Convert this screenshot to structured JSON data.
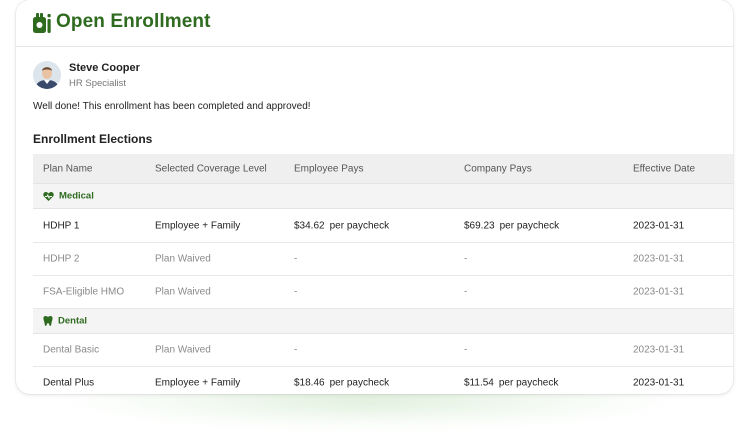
{
  "page": {
    "title": "Open Enrollment",
    "user": {
      "name": "Steve Cooper",
      "role": "HR Specialist"
    },
    "message": "Well done! This enrollment has been completed and approved!",
    "section_title": "Enrollment Elections"
  },
  "colors": {
    "accent": "#2e6b1f",
    "header_bg": "#efefef",
    "group_bg": "#f4f4f4"
  },
  "table": {
    "columns": [
      "Plan Name",
      "Selected Coverage Level",
      "Employee Pays",
      "Company Pays",
      "Effective Date"
    ],
    "groups": [
      {
        "label": "Medical",
        "icon": "heart-icon",
        "rows": [
          {
            "plan": "HDHP 1",
            "coverage": "Employee + Family",
            "employee_pays": "$34.62",
            "employee_suffix": "per paycheck",
            "company_pays": "$69.23",
            "company_suffix": "per paycheck",
            "date": "2023-01-31"
          },
          {
            "plan": "HDHP 2",
            "coverage": "Plan Waived",
            "employee_pays": "-",
            "employee_suffix": "",
            "company_pays": "-",
            "company_suffix": "",
            "date": "2023-01-31"
          },
          {
            "plan": "FSA-Eligible HMO",
            "coverage": "Plan Waived",
            "employee_pays": "-",
            "employee_suffix": "",
            "company_pays": "-",
            "company_suffix": "",
            "date": "2023-01-31"
          }
        ]
      },
      {
        "label": "Dental",
        "icon": "tooth-icon",
        "rows": [
          {
            "plan": "Dental Basic",
            "coverage": "Plan Waived",
            "employee_pays": "-",
            "employee_suffix": "",
            "company_pays": "-",
            "company_suffix": "",
            "date": "2023-01-31"
          },
          {
            "plan": "Dental Plus",
            "coverage": "Employee + Family",
            "employee_pays": "$18.46",
            "employee_suffix": "per paycheck",
            "company_pays": "$11.54",
            "company_suffix": "per paycheck",
            "date": "2023-01-31"
          }
        ]
      }
    ]
  }
}
